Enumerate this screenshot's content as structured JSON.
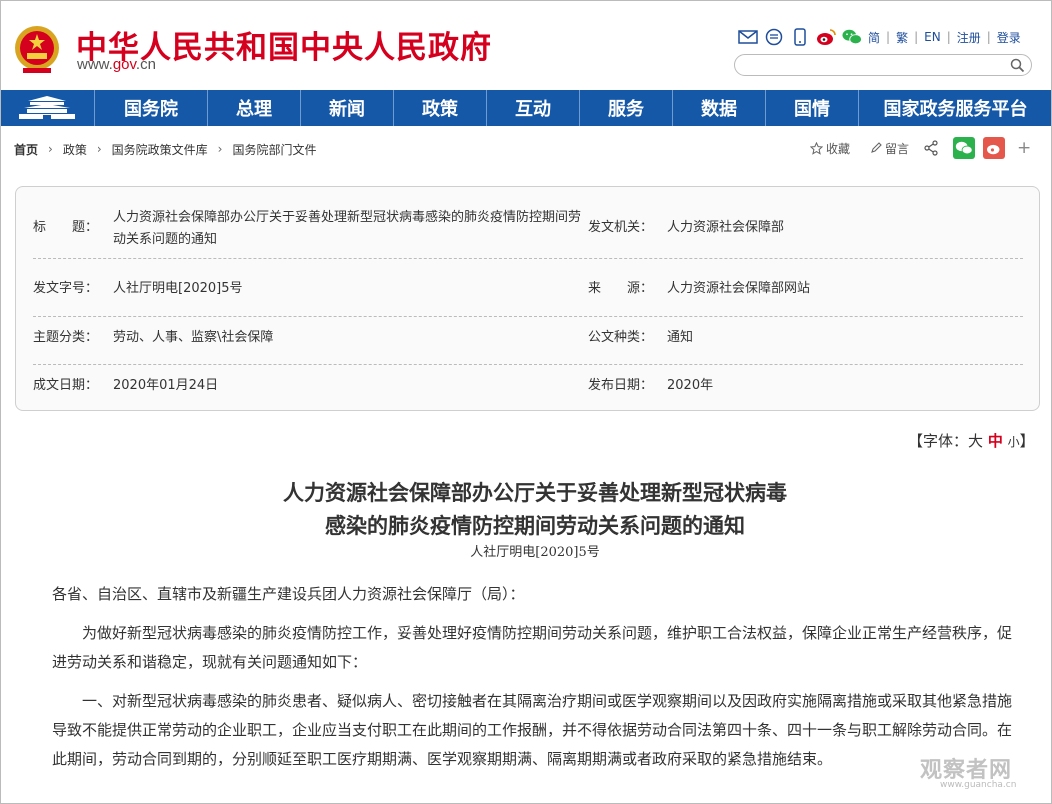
{
  "header": {
    "site_title": "中华人民共和国中央人民政府",
    "domain_prefix": "www.",
    "domain_gov": "gov",
    "domain_suffix": ".cn",
    "links": [
      "简",
      "繁",
      "EN",
      "注册",
      "登录"
    ],
    "icons": [
      "mail-icon",
      "chat-icon",
      "mobile-icon",
      "weibo-icon",
      "wechat-icon"
    ]
  },
  "nav": {
    "items": [
      "国务院",
      "总理",
      "新闻",
      "政策",
      "互动",
      "服务",
      "数据",
      "国情",
      "国家政务服务平台"
    ]
  },
  "breadcrumb": [
    "首页",
    "政策",
    "国务院政策文件库",
    "国务院部门文件"
  ],
  "tools": {
    "favorite": "收藏",
    "comment": "留言",
    "plus": "+"
  },
  "info": {
    "rows": [
      {
        "label": "标　　题：",
        "value": "人力资源社会保障部办公厅关于妥善处理新型冠状病毒感染的肺炎疫情防控期间劳动关系问题的通知",
        "label2": "发文机关：",
        "value2": "人力资源社会保障部"
      },
      {
        "label": "发文字号：",
        "value": "人社厅明电[2020]5号",
        "label2": "来　　源：",
        "value2": "人力资源社会保障部网站"
      },
      {
        "label": "主题分类：",
        "value": "劳动、人事、监察\\社会保障",
        "label2": "公文种类：",
        "value2": "通知"
      },
      {
        "label": "成文日期：",
        "value": "2020年01月24日",
        "label2": "发布日期：",
        "value2": "2020年"
      }
    ]
  },
  "font_size": {
    "prefix": "【字体：",
    "large": "大",
    "medium": "中",
    "small": "小",
    "suffix": "】"
  },
  "article": {
    "title_line1": "人力资源社会保障部办公厅关于妥善处理新型冠状病毒",
    "title_line2": "感染的肺炎疫情防控期间劳动关系问题的通知",
    "doc_number": "人社厅明电[2020]5号",
    "paragraphs": [
      "各省、自治区、直辖市及新疆生产建设兵团人力资源社会保障厅（局）：",
      "为做好新型冠状病毒感染的肺炎疫情防控工作，妥善处理好疫情防控期间劳动关系问题，维护职工合法权益，保障企业正常生产经营秩序，促进劳动关系和谐稳定，现就有关问题通知如下：",
      "一、对新型冠状病毒感染的肺炎患者、疑似病人、密切接触者在其隔离治疗期间或医学观察期间以及因政府实施隔离措施或采取其他紧急措施导致不能提供正常劳动的企业职工，企业应当支付职工在此期间的工作报酬，并不得依据劳动合同法第四十条、四十一条与职工解除劳动合同。在此期间，劳动合同到期的，分别顺延至职工医疗期期满、医学观察期期满、隔离期期满或者政府采取的紧急措施结束。"
    ]
  },
  "watermark": {
    "text": "观察者网",
    "sub": "www.guancha.cn"
  }
}
